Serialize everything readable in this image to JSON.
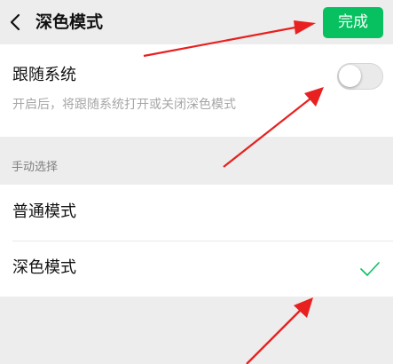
{
  "header": {
    "title": "深色模式",
    "done_label": "完成",
    "back_icon": "chevron-left-icon"
  },
  "follow_system": {
    "label": "跟随系统",
    "description": "开启后，将跟随系统打开或关闭深色模式",
    "enabled": false
  },
  "manual_section": {
    "header": "手动选择",
    "options": [
      {
        "label": "普通模式",
        "selected": false
      },
      {
        "label": "深色模式",
        "selected": true
      }
    ]
  },
  "colors": {
    "accent_green": "#07c160",
    "annotation_red": "#e8201f",
    "background": "#ededed"
  },
  "annotations": {
    "arrow_icon": "red-arrow",
    "count": 3
  }
}
